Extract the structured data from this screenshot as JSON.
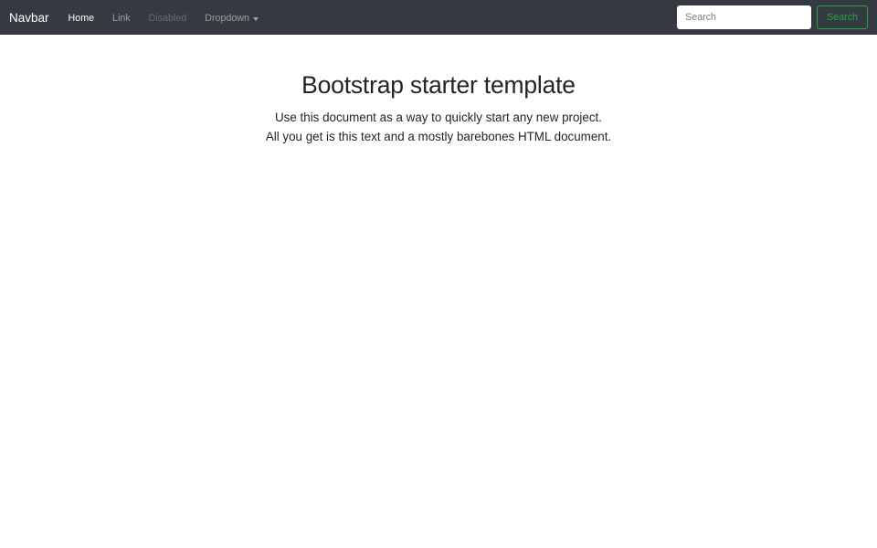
{
  "navbar": {
    "brand": "Navbar",
    "items": [
      {
        "label": "Home",
        "state": "active"
      },
      {
        "label": "Link",
        "state": "normal"
      },
      {
        "label": "Disabled",
        "state": "disabled"
      },
      {
        "label": "Dropdown",
        "state": "dropdown"
      }
    ],
    "search": {
      "placeholder": "Search",
      "button_label": "Search"
    }
  },
  "main": {
    "title": "Bootstrap starter template",
    "lead_line1": "Use this document as a way to quickly start any new project.",
    "lead_line2": "All you get is this text and a mostly barebones HTML document."
  },
  "colors": {
    "navbar_bg": "#343a40",
    "success_green": "#28a745",
    "text_dark": "#212529"
  }
}
